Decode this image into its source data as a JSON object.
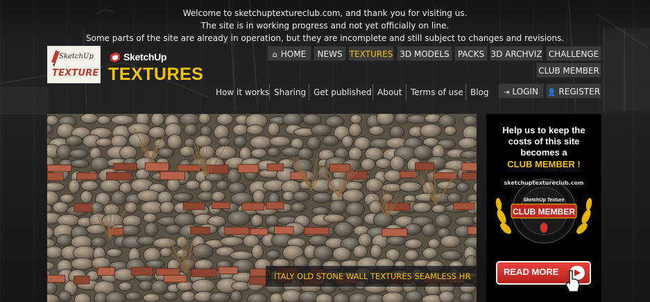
{
  "welcome": {
    "line1": "Welcome to sketchuptextureclub.com, and thank you for visiting us.",
    "line2": "The site is in working progress and not yet officially on line.",
    "line3": "Some parts of the site are already in operation, but they are incomplete and still subject to changes and revisions."
  },
  "logos": {
    "small_top": "SketchUp",
    "small_bottom": "TEXTURE",
    "big_top": "SketchUp",
    "big_bottom": "TEXTURES"
  },
  "nav": {
    "home": "HOME",
    "news": "NEWS",
    "textures": "TEXTURES",
    "models": "3D MODELS",
    "packs": "PACKS",
    "archviz": "3D ARCHVIZ",
    "challenge": "CHALLENGE",
    "club": "CLUB MEMBER"
  },
  "subnav": {
    "how": "How it works",
    "sharing": "Sharing",
    "published": "Get published",
    "about": "About",
    "terms": "Terms of use",
    "blog": "Blog"
  },
  "auth": {
    "login": "LOGIN",
    "register": "REGISTER"
  },
  "hero": {
    "caption": "ITALY OLD STONE WALL TEXTURES SEAMLESS HR"
  },
  "ad": {
    "line1": "Help us to keep the",
    "line2": "costs of this site",
    "line3": "becomes a",
    "line4": "CLUB MEMBER !",
    "badge_ring": "sketchuptextureclub.com",
    "badge_top": "SketchUp Texture",
    "badge_main": "CLUB MEMBER",
    "cta": "READ MORE"
  },
  "colors": {
    "accent": "#f2c500",
    "nav_bg": "#3a3a3a",
    "cta_red": "#d2302a"
  }
}
